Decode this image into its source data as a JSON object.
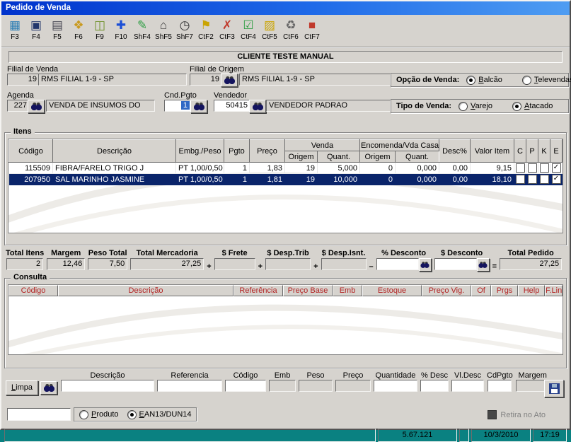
{
  "window": {
    "title": "Pedido de Venda"
  },
  "toolbar": {
    "items": [
      {
        "label": "F3",
        "icon": "search-icon",
        "glyph": "▦",
        "color": "#2e7fb5"
      },
      {
        "label": "F4",
        "icon": "save-icon",
        "glyph": "▣",
        "color": "#22366b"
      },
      {
        "label": "F5",
        "icon": "document-icon",
        "glyph": "▤",
        "color": "#4a4a55"
      },
      {
        "label": "F6",
        "icon": "coins-icon",
        "glyph": "❖",
        "color": "#c99a1f"
      },
      {
        "label": "F9",
        "icon": "jar-icon",
        "glyph": "◫",
        "color": "#6b8e23"
      },
      {
        "label": "F10",
        "icon": "add-icon",
        "glyph": "✚",
        "color": "#1c4fd6"
      },
      {
        "label": "ShF4",
        "icon": "edit-icon",
        "glyph": "✎",
        "color": "#2f9e44"
      },
      {
        "label": "ShF5",
        "icon": "building-icon",
        "glyph": "⌂",
        "color": "#3a3a3a"
      },
      {
        "label": "ShF7",
        "icon": "clock-icon",
        "glyph": "◷",
        "color": "#333333"
      },
      {
        "label": "CtF2",
        "icon": "flag-icon",
        "glyph": "⚑",
        "color": "#caa400"
      },
      {
        "label": "CtF3",
        "icon": "cancel-icon",
        "glyph": "✗",
        "color": "#c0392b"
      },
      {
        "label": "CtF4",
        "icon": "confirm-icon",
        "glyph": "☑",
        "color": "#2f9e44"
      },
      {
        "label": "CtF5",
        "icon": "note-icon",
        "glyph": "▨",
        "color": "#caa400"
      },
      {
        "label": "CtF6",
        "icon": "trash-icon",
        "glyph": "♻",
        "color": "#666666"
      },
      {
        "label": "CtF7",
        "icon": "exit-icon",
        "glyph": "■",
        "color": "#c0392b"
      }
    ]
  },
  "client": {
    "name": "CLIENTE TESTE MANUAL"
  },
  "fields": {
    "filial_venda": {
      "label": "Filial de Venda",
      "code": "19",
      "name": "RMS FILIAL 1-9 - SP"
    },
    "filial_origem": {
      "label": "Filial de Origem",
      "code": "19",
      "name": "RMS FILIAL 1-9 - SP"
    },
    "opcao_venda": {
      "label": "Opção de Venda:",
      "options": [
        {
          "label": "Balcão",
          "selected": true
        },
        {
          "label": "Televendas",
          "selected": false
        }
      ]
    },
    "agenda": {
      "label": "Agenda",
      "code": "227",
      "name": "VENDA DE INSUMOS DO"
    },
    "cnd_pgto": {
      "label": "Cnd.Pgto",
      "value": "1"
    },
    "vendedor": {
      "label": "Vendedor",
      "code": "50415",
      "name": "VENDEDOR PADRAO"
    },
    "tipo_venda": {
      "label": "Tipo de Venda:",
      "options": [
        {
          "label": "Varejo",
          "selected": false
        },
        {
          "label": "Atacado",
          "selected": true
        }
      ]
    }
  },
  "itens": {
    "title": "Itens",
    "columns": {
      "codigo": "Código",
      "descricao": "Descrição",
      "emb": "Embg./Peso",
      "pgto": "Pgto",
      "preco": "Preço",
      "venda": "Venda",
      "origem": "Origem",
      "quant": "Quant.",
      "encomenda": "Encomenda/Vda Casada",
      "desc": "Desc%",
      "valor": "Valor Item",
      "c": "C",
      "p": "P",
      "k": "K",
      "e": "E"
    },
    "rows": [
      {
        "codigo": "115509",
        "descricao": "FIBRA/FARELO TRIGO J",
        "emb_peso": "PT 1,00/0,50",
        "pgto": "1",
        "preco": "1,83",
        "venda_origem": "19",
        "venda_quant": "5,000",
        "enc_origem": "0",
        "enc_quant": "0,000",
        "desc_pct": "0,00",
        "valor_item": "9,15",
        "c": false,
        "p": false,
        "k": false,
        "e": true,
        "selected": false
      },
      {
        "codigo": "207950",
        "descricao": "SAL MARINHO JASMINE",
        "emb_peso": "PT 1,00/0,50",
        "pgto": "1",
        "preco": "1,81",
        "venda_origem": "19",
        "venda_quant": "10,000",
        "enc_origem": "0",
        "enc_quant": "0,000",
        "desc_pct": "0,00",
        "valor_item": "18,10",
        "c": false,
        "p": false,
        "k": false,
        "e": true,
        "selected": true
      }
    ]
  },
  "totals": {
    "total_itens_label": "Total Itens",
    "total_itens": "2",
    "margem_label": "Margem",
    "margem": "12,46",
    "peso_label": "Peso Total",
    "peso": "7,50",
    "mercadoria_label": "Total Mercadoria",
    "mercadoria": "27,25",
    "frete_label": "$ Frete",
    "frete": "",
    "desp_trib_label": "$ Desp.Trib",
    "desp_trib": "",
    "desp_isnt_label": "$ Desp.Isnt.",
    "desp_isnt": "",
    "pct_desconto_label": "% Desconto",
    "pct_desconto": "",
    "desconto_label": "$ Desconto",
    "desconto": "",
    "pedido_label": "Total Pedido",
    "pedido": "27,25",
    "plus": "+",
    "minus": "–",
    "equals": "="
  },
  "consulta": {
    "title": "Consulta",
    "columns": [
      "Código",
      "Descrição",
      "Referência",
      "Preço Base",
      "Emb",
      "Estoque",
      "Preço Vig.",
      "Of",
      "Prgs",
      "Help",
      "F.Linha"
    ]
  },
  "entry": {
    "limpa_label": "Limpa",
    "fields": [
      {
        "label": "Descrição",
        "value": "",
        "readonly": false
      },
      {
        "label": "Referencia",
        "value": "",
        "readonly": false
      },
      {
        "label": "Código",
        "value": "",
        "readonly": false
      },
      {
        "label": "Emb",
        "value": "",
        "readonly": true
      },
      {
        "label": "Peso",
        "value": "",
        "readonly": true
      },
      {
        "label": "Preço",
        "value": "",
        "readonly": true
      },
      {
        "label": "Quantidade",
        "value": "",
        "readonly": false
      },
      {
        "label": "% Desc",
        "value": "",
        "readonly": false
      },
      {
        "label": "Vl.Desc",
        "value": "",
        "readonly": false
      },
      {
        "label": "CdPgto",
        "value": "",
        "readonly": false
      },
      {
        "label": "Margem",
        "value": "",
        "readonly": true
      }
    ]
  },
  "footer": {
    "product_code": "",
    "product_options": [
      {
        "label": "Produto",
        "selected": false
      },
      {
        "label": "EAN13/DUN14",
        "selected": true
      }
    ],
    "retira_label": "Retira no Ato"
  },
  "statusbar": {
    "version": "5.67.121",
    "date": "10/3/2010",
    "time": "17:19"
  }
}
